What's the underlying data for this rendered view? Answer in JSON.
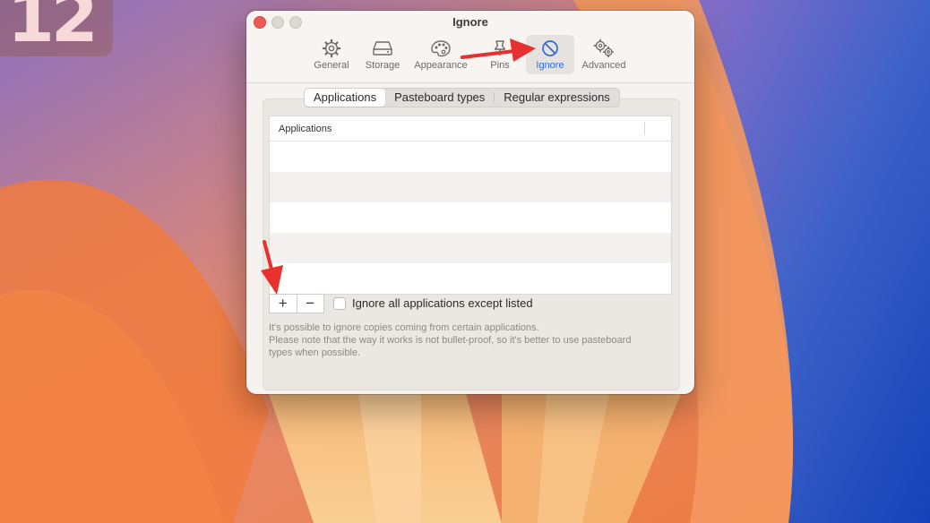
{
  "overlay_text": "12",
  "window": {
    "title": "Ignore"
  },
  "toolbar": {
    "items": [
      {
        "label": "General",
        "icon": "gear-icon"
      },
      {
        "label": "Storage",
        "icon": "drive-icon"
      },
      {
        "label": "Appearance",
        "icon": "palette-icon"
      },
      {
        "label": "Pins",
        "icon": "pin-icon"
      },
      {
        "label": "Ignore",
        "icon": "prohibited-icon",
        "selected": true
      },
      {
        "label": "Advanced",
        "icon": "gears-icon"
      }
    ]
  },
  "tabs": [
    {
      "label": "Applications",
      "selected": true
    },
    {
      "label": "Pasteboard types",
      "selected": false
    },
    {
      "label": "Regular expressions",
      "selected": false
    }
  ],
  "table": {
    "header": "Applications",
    "rows": []
  },
  "controls": {
    "add_label": "+",
    "remove_label": "−",
    "checkbox_label": "Ignore all applications except listed",
    "checkbox_checked": false
  },
  "help_text": [
    "It's possible to ignore copies coming from certain applications.",
    "Please note that the way it works is not bullet-proof, so it's better to use pasteboard",
    "types when possible."
  ],
  "colors": {
    "accent": "#2d6ad8",
    "annotation_arrow": "#e8302e",
    "close_button": "#ed5a54"
  }
}
